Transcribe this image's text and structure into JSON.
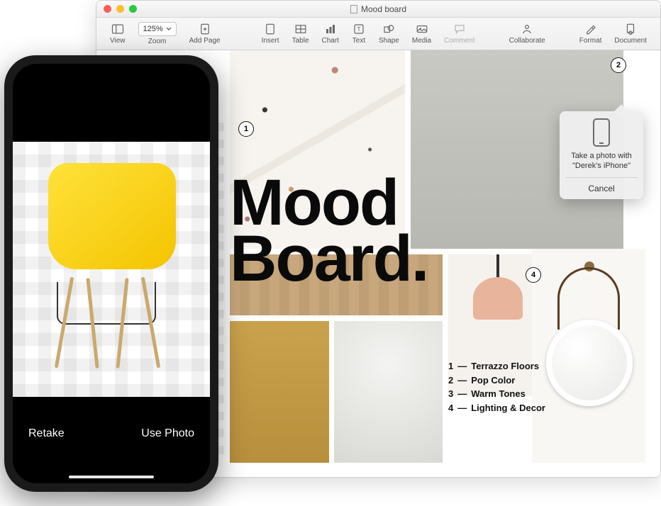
{
  "mac": {
    "window_title": "Mood board",
    "toolbar": {
      "view": "View",
      "zoom_value": "125%",
      "zoom_label": "Zoom",
      "add_page": "Add Page",
      "insert": "Insert",
      "table": "Table",
      "chart": "Chart",
      "text": "Text",
      "shape": "Shape",
      "media": "Media",
      "comment": "Comment",
      "collaborate": "Collaborate",
      "format": "Format",
      "document": "Document"
    },
    "doc": {
      "title_line1": "Mood",
      "title_line2": "Board.",
      "markers": {
        "m1": "1",
        "m2": "2",
        "m4": "4"
      },
      "legend": [
        {
          "n": "1",
          "label": "Terrazzo Floors"
        },
        {
          "n": "2",
          "label": "Pop Color"
        },
        {
          "n": "3",
          "label": "Warm Tones"
        },
        {
          "n": "4",
          "label": "Lighting & Decor"
        }
      ]
    },
    "popover": {
      "line1": "Take a photo with",
      "line2": "\"Derek's iPhone\"",
      "cancel": "Cancel"
    }
  },
  "iphone": {
    "retake": "Retake",
    "use_photo": "Use Photo"
  }
}
